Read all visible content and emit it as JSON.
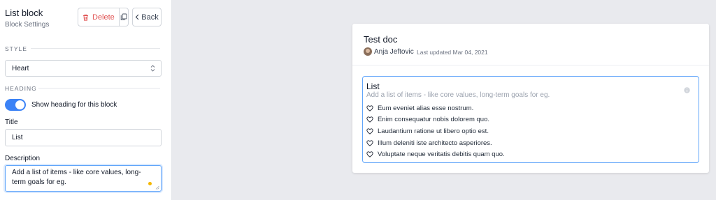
{
  "panel": {
    "title": "List block",
    "subtitle": "Block Settings",
    "delete_label": "Delete",
    "back_label": "Back",
    "style_section": "STYLE",
    "style_value": "Heart",
    "heading_section": "HEADING",
    "toggle_label": "Show heading for this block",
    "toggle_on": true,
    "title_label": "Title",
    "title_value": "List",
    "description_label": "Description",
    "description_value": "Add a list of items - like core values, long-term goals for eg."
  },
  "doc": {
    "title": "Test doc",
    "author": "Anja Jeftovic",
    "updated": "Last updated Mar 04, 2021",
    "list": {
      "title": "List",
      "description": "Add a list of items - like core values, long-term goals for eg.",
      "item_icon": "heart-icon",
      "items": [
        "Eum eveniet alias esse nostrum.",
        "Enim consequatur nobis dolorem quo.",
        "Laudantium ratione ut libero optio est.",
        "Illum deleniti iste architecto asperiores.",
        "Voluptate neque veritatis debitis quam quo."
      ]
    }
  },
  "colors": {
    "accent": "#3b82f6",
    "danger": "#e05252",
    "background": "#e9eaee",
    "unsaved_dot": "#f5b700"
  }
}
